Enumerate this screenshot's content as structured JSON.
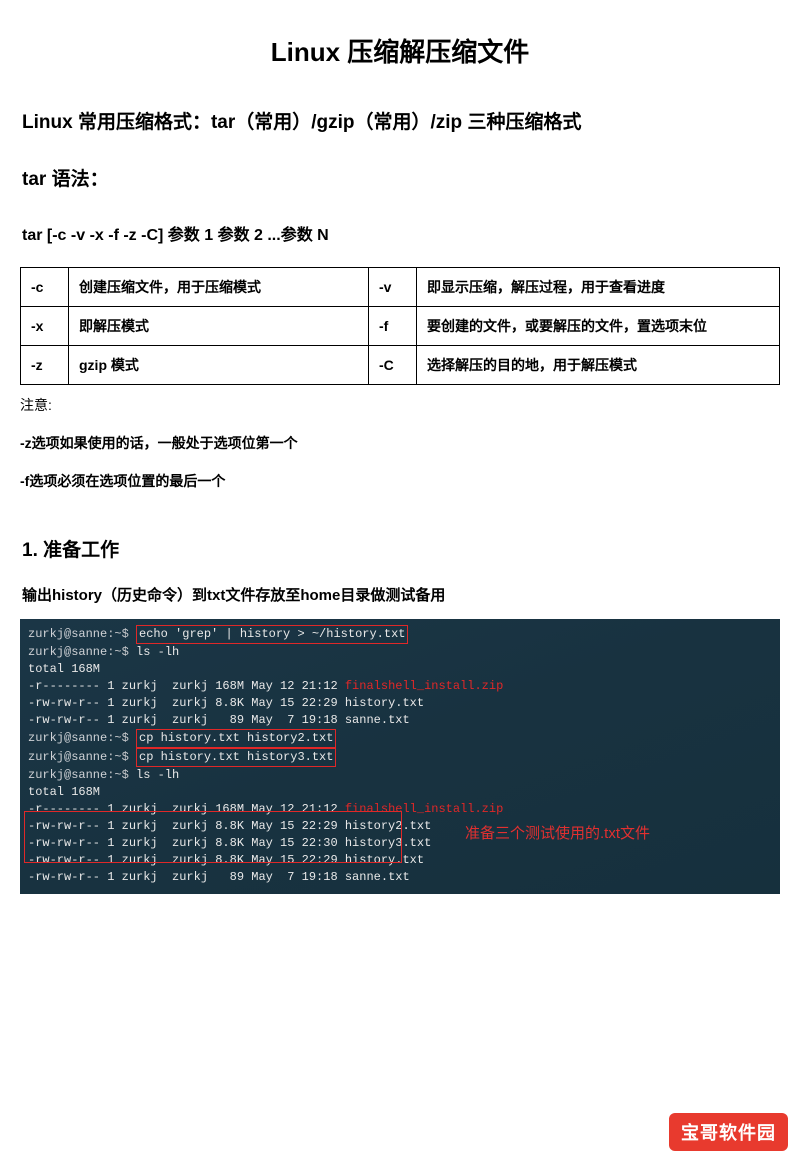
{
  "title": "Linux 压缩解压缩文件",
  "formats_heading": "Linux 常用压缩格式：tar（常用）/gzip（常用）/zip 三种压缩格式",
  "tar_heading": "tar 语法：",
  "tar_syntax": "tar [-c -v -x -f -z -C]  参数 1  参数 2 ...参数 N",
  "table": {
    "rows": [
      {
        "flag1": "-c",
        "desc1": "创建压缩文件，用于压缩模式",
        "flag2": "-v",
        "desc2": "即显示压缩，解压过程，用于查看进度"
      },
      {
        "flag1": "-x",
        "desc1": "即解压模式",
        "flag2": "-f",
        "desc2": "要创建的文件，或要解压的文件，置选项末位"
      },
      {
        "flag1": "-z",
        "desc1": "gzip 模式",
        "flag2": "-C",
        "desc2": "选择解压的目的地，用于解压模式"
      }
    ]
  },
  "note_label": "注意:",
  "notes": [
    "-z选项如果使用的话，一般处于选项位第一个",
    "-f选项必须在选项位置的最后一个"
  ],
  "step1_heading": "1. 准备工作",
  "step1_desc": "输出history（历史命令）到txt文件存放至home目录做测试备用",
  "terminal": {
    "prompt_user": "zurkj@sanne",
    "prompt_path": ":~$",
    "cmd1": "echo 'grep' | history > ~/history.txt",
    "cmd2": "ls -lh",
    "total": "total 168M",
    "ls1_perm": "-r--------",
    "ls1_rest": " 1 zurkj  zurkj 168M May 12 21:12 ",
    "ls1_file": "finalshell_install.zip",
    "ls2_perm": "-rw-rw-r--",
    "ls2_rest": " 1 zurkj  zurkj 8.8K May 15 22:29 history.txt",
    "ls3_perm": "-rw-rw-r--",
    "ls3_rest": " 1 zurkj  zurkj   89 May  7 19:18 sanne.txt",
    "cmd3": "cp history.txt history2.txt",
    "cmd4": "cp history.txt history3.txt",
    "cmd5": "ls -lh",
    "total2": "total 168M",
    "ls4_perm": "-r--------",
    "ls4_rest": " 1 zurkj  zurkj 168M May 12 21:12 ",
    "ls4_file": "finalshell_install.zip",
    "ls5": "-rw-rw-r-- 1 zurkj  zurkj 8.8K May 15 22:29 history2.txt",
    "ls6": "-rw-rw-r-- 1 zurkj  zurkj 8.8K May 15 22:30 history3.txt",
    "ls7": "-rw-rw-r-- 1 zurkj  zurkj 8.8K May 15 22:29 history.txt",
    "ls8_perm": "-rw-rw-r--",
    "ls8_rest": " 1 zurkj  zurkj   89 May  7 19:18 sanne.txt",
    "annotation": "准备三个测试使用的.txt文件"
  },
  "watermark": "宝哥软件园"
}
